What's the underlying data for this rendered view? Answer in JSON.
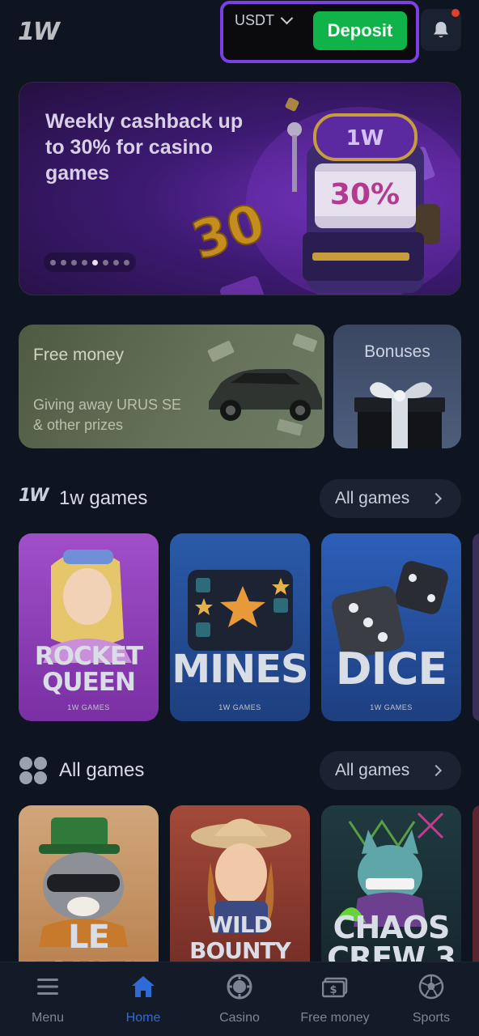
{
  "header": {
    "logo": "1W",
    "currency": "USDT",
    "deposit_label": "Deposit",
    "notification_dot_color": "#e0402e"
  },
  "banner": {
    "title": "Weekly cashback up to 30% for casino games",
    "slot_label": "1W",
    "slot_reels": "30%",
    "big_number": "30",
    "slide_count": 8,
    "active_slide": 5
  },
  "promos": {
    "money": {
      "title": "Free money",
      "subtitle": "Giving away URUS SE & other prizes"
    },
    "bonus": {
      "title": "Bonuses"
    }
  },
  "section_1w": {
    "icon_text": "1W",
    "title": "1w games",
    "all_label": "All games",
    "games": [
      {
        "name": "ROCKET QUEEN",
        "sub": "1W GAMES"
      },
      {
        "name": "MINES",
        "sub": "1W GAMES"
      },
      {
        "name": "DICE",
        "sub": "1W GAMES"
      }
    ]
  },
  "section_all": {
    "title": "All games",
    "all_label": "All games",
    "games": [
      {
        "name": "LE BANDIT"
      },
      {
        "name": "WILD BOUNTY SHOWDOWN"
      },
      {
        "name": "CHAOS CREW 3"
      }
    ]
  },
  "nav": {
    "items": [
      {
        "label": "Menu",
        "icon": "menu-icon"
      },
      {
        "label": "Home",
        "icon": "home-icon",
        "active": true
      },
      {
        "label": "Casino",
        "icon": "casino-chip-icon"
      },
      {
        "label": "Free money",
        "icon": "cash-icon"
      },
      {
        "label": "Sports",
        "icon": "soccer-ball-icon"
      }
    ],
    "active_color": "#2d6bd6"
  },
  "colors": {
    "deposit": "#10b34a",
    "highlight_border": "#7b3fe4",
    "background": "#0e1420"
  }
}
